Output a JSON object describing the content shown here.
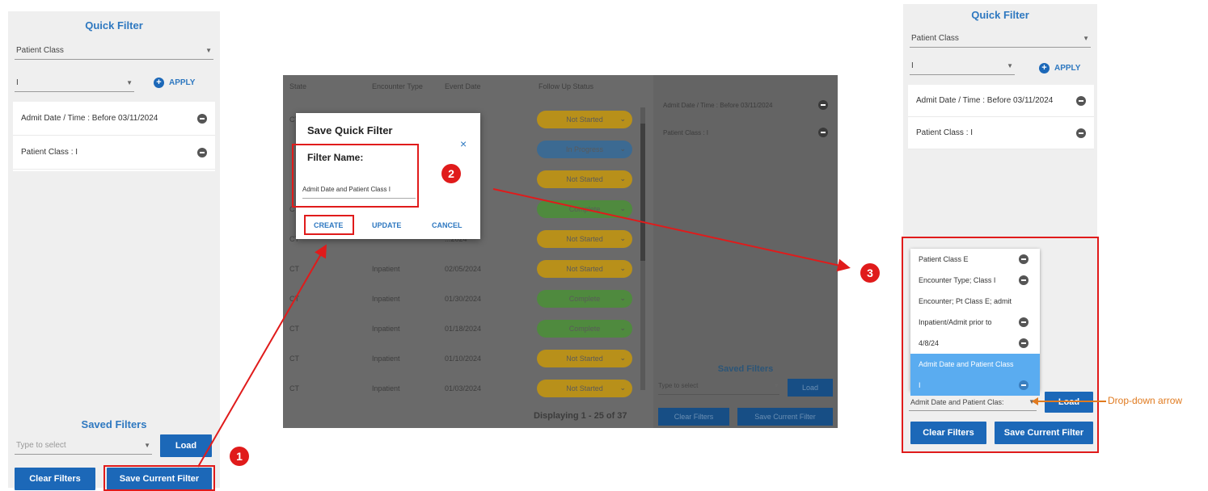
{
  "left_panel": {
    "title": "Quick Filter",
    "field_select": "Patient Class",
    "value_select": "I",
    "apply_label": "APPLY",
    "chips": [
      "Admit Date / Time : Before 03/11/2024",
      "Patient Class : I"
    ],
    "saved_title": "Saved Filters",
    "type_placeholder": "Type to select",
    "load_label": "Load",
    "clear_label": "Clear Filters",
    "save_label": "Save Current Filter"
  },
  "middle": {
    "headers": [
      "State",
      "Encounter Type",
      "Event Date",
      "Follow Up Status"
    ],
    "rows": [
      {
        "state": "CT",
        "type": "",
        "date": "...2024",
        "status": "Not Started",
        "color": "#b8901a"
      },
      {
        "state": "",
        "type": "",
        "date": "...2024",
        "status": "In Progress",
        "color": "#3c6a92"
      },
      {
        "state": "",
        "type": "",
        "date": "...2024",
        "status": "Not Started",
        "color": "#b8901a"
      },
      {
        "state": "C",
        "type": "",
        "date": "...2024",
        "status": "Complete",
        "color": "#4f8a3e"
      },
      {
        "state": "CT",
        "type": "",
        "date": "...2024",
        "status": "Not Started",
        "color": "#b8901a"
      },
      {
        "state": "CT",
        "type": "Inpatient",
        "date": "02/05/2024",
        "status": "Not Started",
        "color": "#b8901a"
      },
      {
        "state": "CT",
        "type": "Inpatient",
        "date": "01/30/2024",
        "status": "Complete",
        "color": "#4f8a3e"
      },
      {
        "state": "CT",
        "type": "Inpatient",
        "date": "01/18/2024",
        "status": "Complete",
        "color": "#4f8a3e"
      },
      {
        "state": "CT",
        "type": "Inpatient",
        "date": "01/10/2024",
        "status": "Not Started",
        "color": "#b8901a"
      },
      {
        "state": "CT",
        "type": "Inpatient",
        "date": "01/03/2024",
        "status": "Not Started",
        "color": "#b8901a"
      }
    ],
    "displaying": "Displaying 1 - 25 of 37",
    "side_chips": [
      "Admit Date / Time : Before 03/11/2024",
      "Patient Class : I"
    ],
    "saved_title": "Saved Filters",
    "type_placeholder": "Type to select",
    "load_label": "Load",
    "clear_label": "Clear Filters",
    "save_label": "Save Current Filter"
  },
  "modal": {
    "title": "Save Quick Filter",
    "close": "×",
    "filter_label": "Filter Name:",
    "filter_value": "Admit Date and Patient Class I",
    "create": "CREATE",
    "update": "UPDATE",
    "cancel": "CANCEL"
  },
  "right_panel": {
    "title": "Quick Filter",
    "field_select": "Patient Class",
    "value_select": "I",
    "apply_label": "APPLY",
    "chips": [
      "Admit Date / Time : Before 03/11/2024",
      "Patient Class : I"
    ],
    "dropdown_items": [
      {
        "label": "Patient Class E",
        "remove": true,
        "selected": false
      },
      {
        "label": "Encounter Type; Class I",
        "remove": true,
        "selected": false
      },
      {
        "label": "Encounter; Pt Class E; admit",
        "remove": false,
        "selected": false
      },
      {
        "label": "Inpatient/Admit prior to",
        "remove": true,
        "selected": false
      },
      {
        "label": "4/8/24",
        "remove": true,
        "selected": false
      },
      {
        "label": "Admit Date and Patient Class",
        "remove": false,
        "selected": true
      },
      {
        "label": "I",
        "remove": true,
        "selected": true
      }
    ],
    "combo_value": "Admit Date and Patient Clas:",
    "load_label": "Load",
    "clear_label": "Clear Filters",
    "save_label": "Save Current Filter",
    "annotation": "Drop-down arrow"
  },
  "markers": [
    "1",
    "2",
    "3"
  ],
  "colors": {
    "accent": "#1c68b8",
    "annotation_red": "#e01b1b",
    "annotation_orange": "#e07a1f",
    "selected_row": "#5aacf0"
  }
}
